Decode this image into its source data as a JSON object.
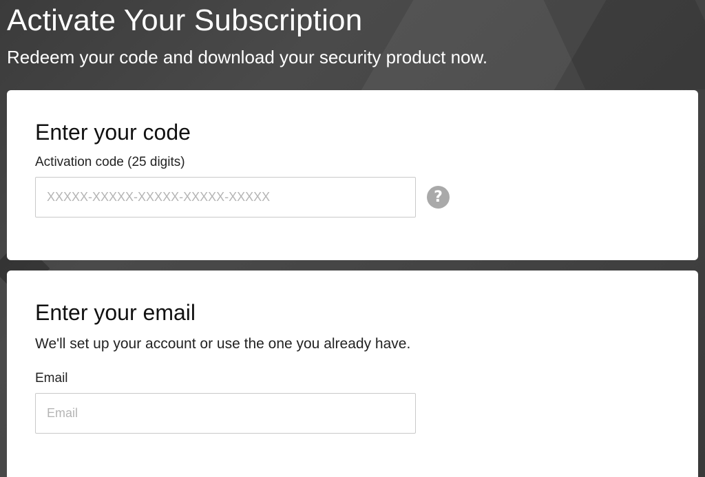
{
  "hero": {
    "title": "Activate Your Subscription",
    "subtitle": "Redeem your code and download your security product now."
  },
  "code_section": {
    "title": "Enter your code",
    "label": "Activation code (25 digits)",
    "placeholder": "XXXXX-XXXXX-XXXXX-XXXXX-XXXXX",
    "value": "",
    "help_icon": "question-mark-circle",
    "help_glyph": "?"
  },
  "email_section": {
    "title": "Enter your email",
    "description": "We'll set up your account or use the one you already have.",
    "label": "Email",
    "placeholder": "Email",
    "value": ""
  },
  "colors": {
    "background": "#444444",
    "card": "#ffffff",
    "input_border": "#c9c9c9",
    "placeholder": "#b5b5b5",
    "help_icon": "#a9a9a9"
  }
}
